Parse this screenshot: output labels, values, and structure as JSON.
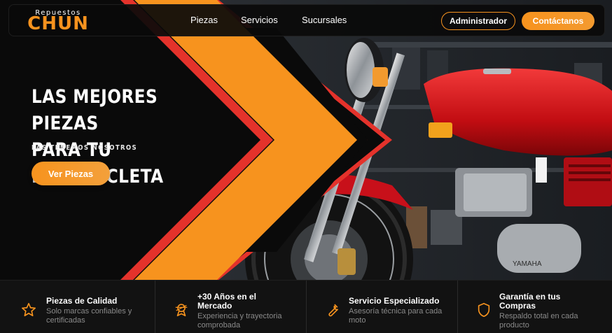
{
  "brand": {
    "small": "Repuestos",
    "big": "CHUN",
    "accent": "#f7931e"
  },
  "nav": {
    "links": [
      "Piezas",
      "Servicios",
      "Sucursales"
    ],
    "admin_label": "Administrador",
    "contact_label": "Contáctanos"
  },
  "hero": {
    "title_line1": "LAS MEJORES PIEZAS",
    "title_line2": "PARA TU MOTOCICLETA",
    "subtitle": "LAS TENEMOS NOSOTROS",
    "cta_label": "Ver Piezas"
  },
  "features": [
    {
      "icon": "star-icon",
      "title_line1": "Piezas de Calidad",
      "title_line2": "",
      "desc_line1": "Solo marcas confiables y",
      "desc_line2": "certificadas"
    },
    {
      "icon": "award-icon",
      "title_line1": "+30 Años en el",
      "title_line2": "Mercado",
      "desc_line1": "Experiencia y trayectoria",
      "desc_line2": "comprobada"
    },
    {
      "icon": "wrench-icon",
      "title_line1": "Servicio Especializado",
      "title_line2": "",
      "desc_line1": "Asesoría técnica para cada",
      "desc_line2": "moto"
    },
    {
      "icon": "shield-icon",
      "title_line1": "Garantía en tus",
      "title_line2": "Compras",
      "desc_line1": "Respaldo total en cada",
      "desc_line2": "producto"
    }
  ]
}
